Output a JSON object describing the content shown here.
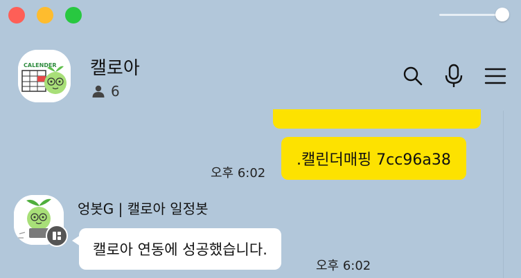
{
  "room": {
    "title": "캘로아",
    "member_count": "6",
    "avatar_text": "CALENDER"
  },
  "header_icons": [
    "search-icon",
    "microphone-icon",
    "menu-icon"
  ],
  "messages": [
    {
      "sender": "me",
      "text": ".캘린더매핑 7cc96a38",
      "time": "오후 6:02"
    },
    {
      "sender": "bot",
      "name": "엉봇G | 캘로아 일정봇",
      "text": "캘로아 연동에 성공했습니다.",
      "time": "오후 6:02"
    }
  ],
  "colors": {
    "background": "#b2c7da",
    "my_bubble": "#fde200",
    "other_bubble": "#ffffff"
  }
}
